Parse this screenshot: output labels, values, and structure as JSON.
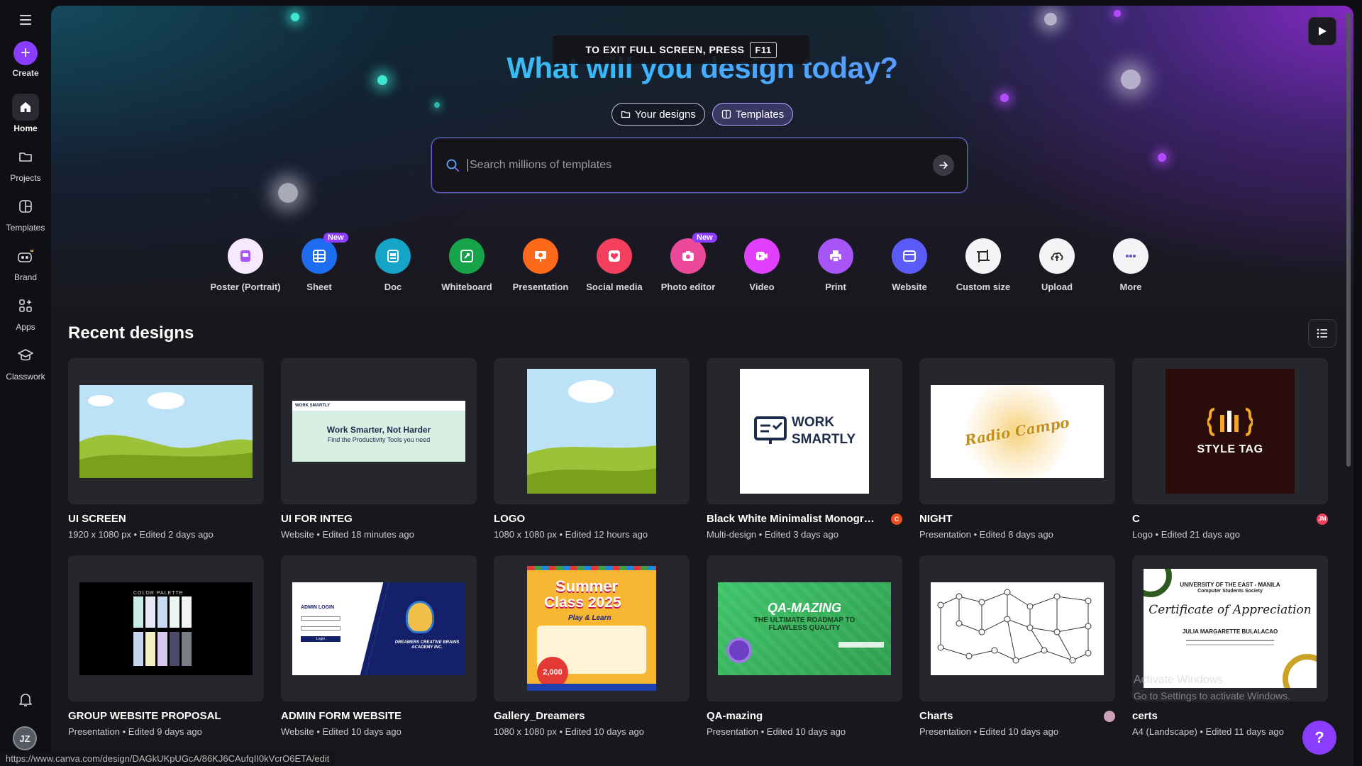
{
  "rail": {
    "create": "Create",
    "items": [
      {
        "label": "Home",
        "icon": "home-icon"
      },
      {
        "label": "Projects",
        "icon": "folder-icon"
      },
      {
        "label": "Templates",
        "icon": "templates-icon"
      },
      {
        "label": "Brand",
        "icon": "brand-icon"
      },
      {
        "label": "Apps",
        "icon": "apps-icon"
      },
      {
        "label": "Classwork",
        "icon": "classwork-icon"
      }
    ],
    "avatar_initials": "JZ"
  },
  "banner": {
    "text": "TO EXIT FULL SCREEN, PRESS",
    "key": "F11"
  },
  "hero": {
    "headline": "What will you design today?",
    "tab_your_designs": "Your designs",
    "tab_templates": "Templates",
    "search_placeholder": "Search millions of templates"
  },
  "quick_actions": [
    {
      "label": "Poster (Portrait)",
      "color": "#f5e8ff",
      "icon": "poster-icon"
    },
    {
      "label": "Sheet",
      "color": "#1e6cf0",
      "icon": "sheet-icon",
      "badge": "New"
    },
    {
      "label": "Doc",
      "color": "#15a3c7",
      "icon": "doc-icon"
    },
    {
      "label": "Whiteboard",
      "color": "#16a34a",
      "icon": "whiteboard-icon"
    },
    {
      "label": "Presentation",
      "color": "#ff6a1a",
      "icon": "presentation-icon"
    },
    {
      "label": "Social media",
      "color": "#f43f5e",
      "icon": "heart-icon"
    },
    {
      "label": "Photo editor",
      "color": "#ec4899",
      "icon": "camera-icon",
      "badge": "New"
    },
    {
      "label": "Video",
      "color": "#e040fb",
      "icon": "video-icon"
    },
    {
      "label": "Print",
      "color": "#a855f7",
      "icon": "print-icon"
    },
    {
      "label": "Website",
      "color": "#5b5bf7",
      "icon": "website-icon"
    },
    {
      "label": "Custom size",
      "color": "#f4f4f6",
      "icon": "custom-size-icon"
    },
    {
      "label": "Upload",
      "color": "#f4f4f6",
      "icon": "upload-icon"
    },
    {
      "label": "More",
      "color": "#f4f4f6",
      "icon": "more-icon"
    }
  ],
  "recent": {
    "title": "Recent designs",
    "designs": [
      {
        "name": "UI SCREEN",
        "meta": "1920 x 1080 px • Edited 2 days ago",
        "thumb": "landscape"
      },
      {
        "name": "UI FOR INTEG",
        "meta": "Website • Edited 18 minutes ago",
        "thumb": "website",
        "thumb_heading": "Work Smarter, Not Harder",
        "thumb_sub": "Find the Productivity Tools you need",
        "thumb_logo": "WORK SMARTLY"
      },
      {
        "name": "LOGO",
        "meta": "1080 x 1080 px • Edited 12 hours ago",
        "thumb": "landscape-square"
      },
      {
        "name": "Black White Minimalist Monogram...",
        "meta": "Multi-design • Edited 3 days ago",
        "thumb": "workly",
        "thumb_line1": "WORK",
        "thumb_line2": "SMARTLY",
        "owner": "C",
        "owner_color": "#ef4d1e"
      },
      {
        "name": "NIGHT",
        "meta": "Presentation • Edited 8 days ago",
        "thumb": "burst",
        "thumb_text": "Radio Campo"
      },
      {
        "name": "C",
        "meta": "Logo • Edited 21 days ago",
        "thumb": "styletag",
        "thumb_text": "STYLE TAG",
        "owner": "JM",
        "owner_color": "#f43f5e"
      },
      {
        "name": "GROUP WEBSITE PROPOSAL",
        "meta": "Presentation • Edited 9 days ago",
        "thumb": "palette",
        "thumb_text": "COLOR PALETTE"
      },
      {
        "name": "ADMIN FORM WEBSITE",
        "meta": "Website • Edited 10 days ago",
        "thumb": "admin",
        "thumb_title": "ADMIN LOGIN",
        "thumb_btn": "Login",
        "thumb_school": "DREAMERS CREATIVE BRAINS ACADEMY INC."
      },
      {
        "name": "Gallery_Dreamers",
        "meta": "1080 x 1080 px • Edited 10 days ago",
        "thumb": "summer",
        "thumb_line1": "Summer",
        "thumb_line2": "Class 2025",
        "thumb_sub": "Play & Learn",
        "thumb_price": "2,000"
      },
      {
        "name": "QA-mazing",
        "meta": "Presentation • Edited 10 days ago",
        "thumb": "qa",
        "thumb_title": "QA-MAZING",
        "thumb_sub": "THE ULTIMATE ROADMAP TO FLAWLESS QUALITY"
      },
      {
        "name": "Charts",
        "meta": "Presentation • Edited 10 days ago",
        "thumb": "chart",
        "owner": "",
        "owner_color": "#c9a0b8"
      },
      {
        "name": "certs",
        "meta": "A4 (Landscape) • Edited 11 days ago",
        "thumb": "cert",
        "thumb_org": "UNIVERSITY OF THE EAST - MANILA",
        "thumb_dept": "Computer Students Society",
        "thumb_title": "Certificate of Appreciation",
        "thumb_recipient": "JULIA MARGARETTE BULALACAO"
      }
    ]
  },
  "watermark": {
    "line1": "Activate Windows",
    "line2": "Go to Settings to activate Windows."
  },
  "help_label": "?",
  "status_url": "https://www.canva.com/design/DAGkUKpUGcA/86KJ6CAufqII0kVcrO6ETA/edit"
}
